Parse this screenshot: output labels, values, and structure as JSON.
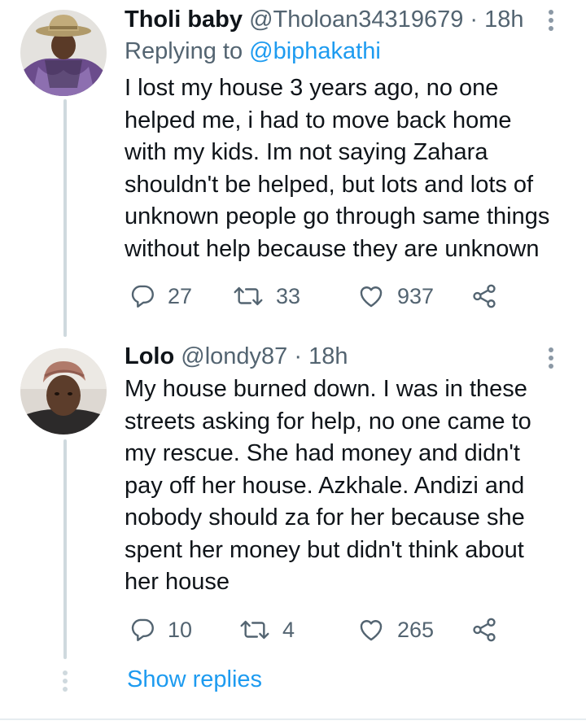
{
  "tweets": [
    {
      "display_name": "Tholi baby",
      "handle": "@Tholoan34319679",
      "time": "18h",
      "replying_prefix": "Replying to",
      "replying_to": "@biphakathi",
      "lines": [
        "I lost my house 3 years ago, no one",
        "helped me, i had to move back home",
        "with my kids. Im not saying Zahara",
        "shouldn't be helped, but lots and lots of",
        "unknown people go through same things",
        "without help because they are unknown"
      ],
      "replies": "27",
      "retweets": "33",
      "likes": "937"
    },
    {
      "display_name": "Lolo",
      "handle": "@londy87",
      "time": "18h",
      "lines": [
        "My house burned down. I was in these",
        "streets asking for help, no one came to",
        "my rescue. She had money and didn't",
        "pay off her house. Azkhale. Andizi and",
        "nobody should za for her because she",
        "spent her money but didn't think about",
        "her house"
      ],
      "replies": "10",
      "retweets": "4",
      "likes": "265"
    }
  ],
  "show_replies": "Show replies",
  "separator": " · ",
  "colors": {
    "accent": "#1d9bf0",
    "secondary": "#536471",
    "text": "#0f1419"
  },
  "icons": [
    "reply-icon",
    "retweet-icon",
    "like-icon",
    "share-icon",
    "more-icon"
  ]
}
